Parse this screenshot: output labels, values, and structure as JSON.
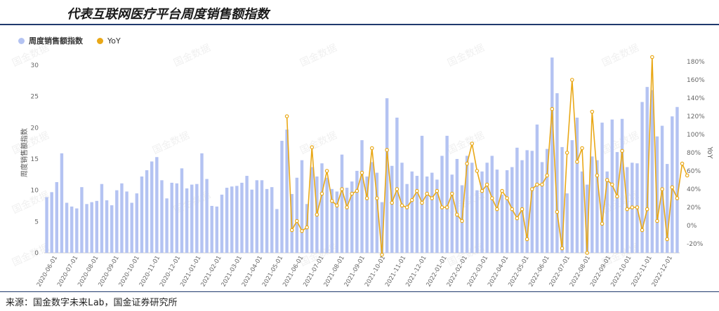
{
  "title": "代表互联网医疗平台周度销售额指数",
  "source": "来源：国金数字未来Lab，国金证券研究所",
  "watermark": "国金数据",
  "chart_data": {
    "type": "bar+line",
    "series": [
      {
        "name": "周度销售额指数",
        "type": "bar",
        "axis": "left",
        "color": "#b4c3f2",
        "values": [
          8.9,
          9.7,
          11.3,
          15.9,
          8.0,
          7.4,
          7.1,
          10.5,
          7.8,
          8.1,
          8.3,
          11.0,
          8.4,
          7.6,
          10.0,
          11.1,
          9.8,
          8.0,
          9.5,
          12.2,
          13.2,
          14.6,
          15.3,
          11.6,
          8.7,
          11.2,
          11.1,
          13.5,
          10.3,
          10.9,
          11.0,
          15.9,
          11.8,
          7.5,
          7.4,
          9.3,
          10.4,
          10.6,
          10.7,
          11.2,
          12.3,
          10.1,
          11.6,
          11.6,
          10.2,
          10.5,
          7.0,
          17.9,
          19.7,
          9.4,
          12.0,
          14.8,
          7.8,
          13.7,
          12.2,
          14.3,
          12.0,
          10.2,
          9.8,
          15.7,
          10.4,
          11.4,
          13.1,
          18.0,
          12.2,
          14.5,
          12.8,
          8.1,
          24.7,
          13.9,
          21.6,
          14.4,
          11.0,
          13.0,
          12.3,
          18.7,
          12.2,
          12.8,
          11.7,
          15.5,
          18.7,
          12.5,
          15.0,
          10.8,
          15.5,
          14.4,
          10.0,
          13.0,
          14.4,
          15.5,
          13.3,
          9.3,
          13.2,
          13.7,
          16.8,
          14.8,
          16.4,
          16.3,
          20.5,
          14.5,
          16.6,
          31.2,
          25.5,
          16.9,
          9.5,
          18.0,
          21.6,
          13.0,
          10.9,
          15.4,
          14.8,
          20.8,
          13.0,
          21.3,
          16.1,
          21.4,
          13.7,
          14.4,
          14.3,
          24.1,
          26.5,
          26.0,
          18.6,
          20.3,
          14.2,
          21.8,
          23.3
        ]
      },
      {
        "name": "YoY",
        "type": "line",
        "axis": "right",
        "color": "#e9a817",
        "start_index": 48,
        "values": [
          120,
          -5,
          5,
          -6,
          -2,
          86,
          12,
          35,
          60,
          27,
          22,
          40,
          20,
          35,
          38,
          58,
          30,
          85,
          30,
          -32,
          83,
          25,
          40,
          22,
          20,
          28,
          38,
          25,
          35,
          30,
          38,
          20,
          20,
          35,
          12,
          5,
          68,
          90,
          60,
          38,
          45,
          30,
          18,
          38,
          30,
          18,
          8,
          18,
          -15,
          40,
          45,
          45,
          55,
          128,
          15,
          -25,
          80,
          160,
          70,
          85,
          -30,
          125,
          55,
          2,
          50,
          45,
          32,
          82,
          18,
          20,
          20,
          -5,
          18,
          185,
          5,
          40,
          -15,
          42,
          30,
          68,
          55
        ]
      }
    ],
    "x_tick_labels": [
      "2020-06-01",
      "2020-07-01",
      "2020-08-01",
      "2020-09-01",
      "2020-10-01",
      "2020-11-01",
      "2020-12-01",
      "2021-01-01",
      "2021-02-01",
      "2021-03-01",
      "2021-04-01",
      "2021-05-01",
      "2021-06-01",
      "2021-07-01",
      "2021-08-01",
      "2021-09-01",
      "2021-10-01",
      "2021-11-01",
      "2021-12-01",
      "2022-01-01",
      "2022-02-01",
      "2022-03-01",
      "2022-04-01",
      "2022-05-01",
      "2022-06-01",
      "2022-07-01",
      "2022-08-01",
      "2022-09-01",
      "2022-10-01",
      "2022-11-01",
      "2022-12-01"
    ],
    "ylabel": "周度销售额指数",
    "y2label": "YoY",
    "ylim": [
      0,
      32
    ],
    "yticks": [
      0,
      5,
      10,
      15,
      20,
      25,
      30
    ],
    "y2lim": [
      -30,
      190
    ],
    "y2ticks": [
      -20,
      0,
      20,
      40,
      60,
      80,
      100,
      120,
      140,
      160,
      180
    ],
    "y2tick_suffix": "%",
    "legend_position": "top-left",
    "grid": false
  }
}
